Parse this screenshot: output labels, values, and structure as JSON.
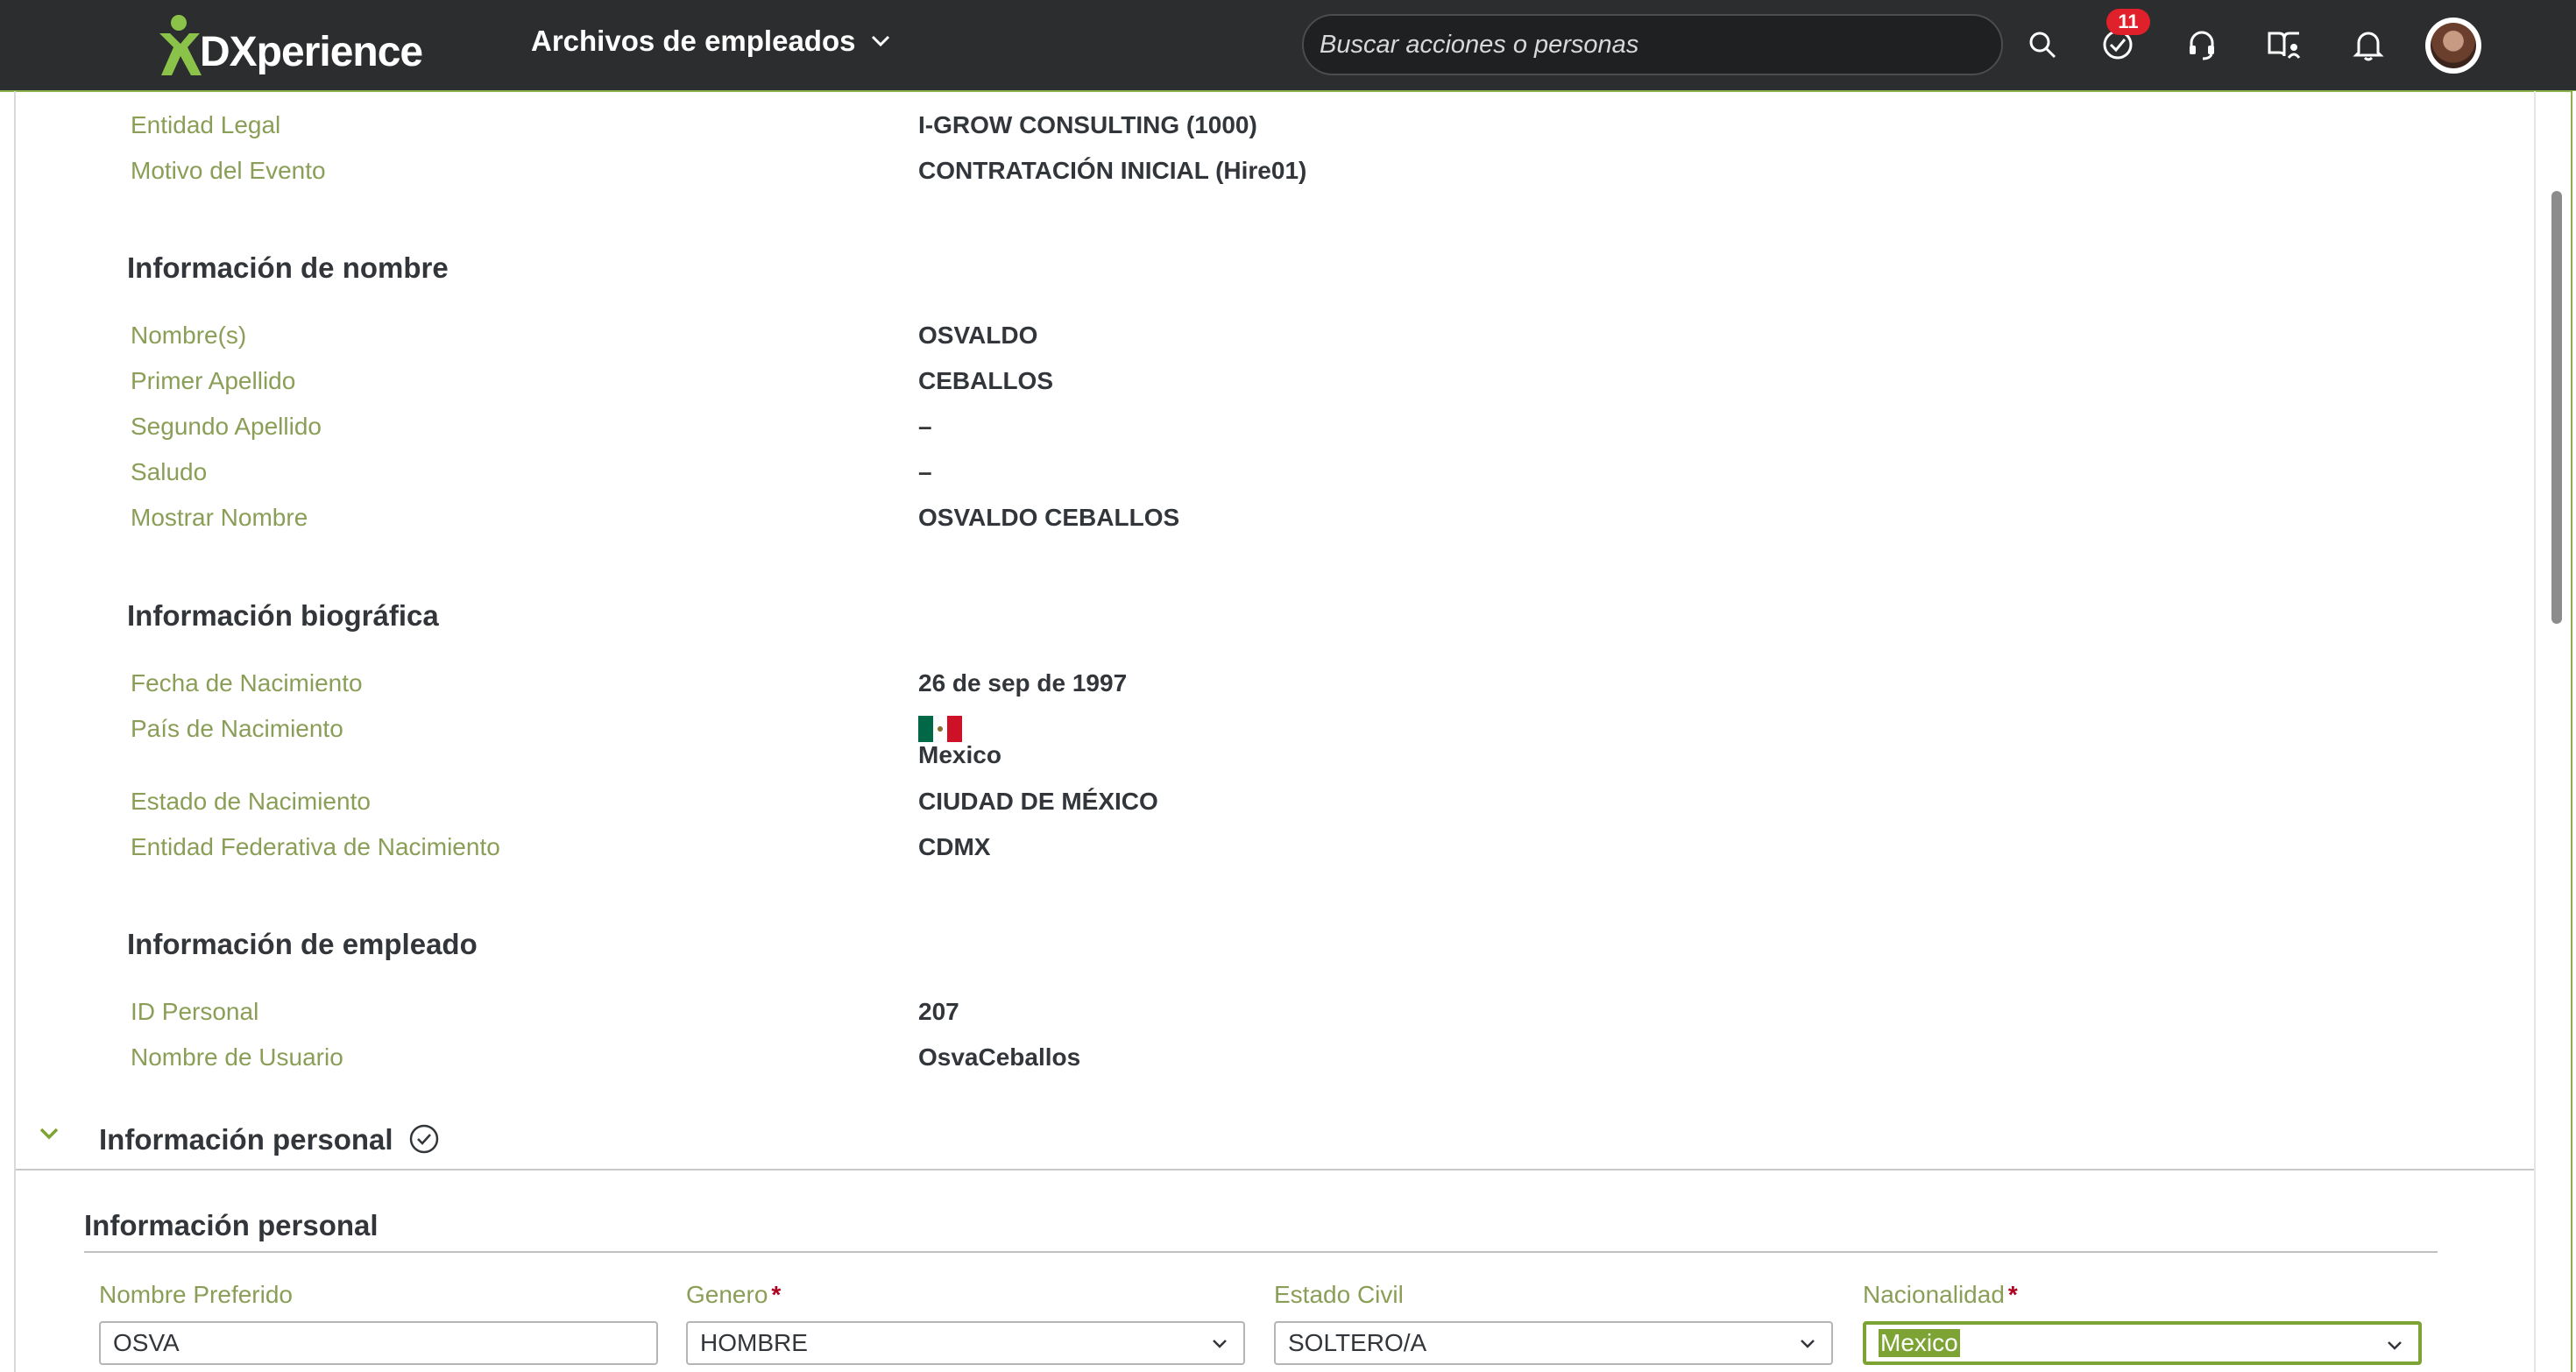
{
  "header": {
    "logo_text": "DXperience",
    "menu_title": "Archivos de empleados",
    "search_placeholder": "Buscar acciones o personas",
    "todo_badge": "11",
    "icons": [
      "search-icon",
      "todo-check-icon",
      "support-headset-icon",
      "learning-book-icon",
      "notification-bell-icon"
    ]
  },
  "event": {
    "rows": [
      {
        "label": "Entidad Legal",
        "value": "I-GROW CONSULTING (1000)"
      },
      {
        "label": "Motivo del Evento",
        "value": "CONTRATACIÓN INICIAL (Hire01)"
      }
    ]
  },
  "name_info": {
    "title": "Información de nombre",
    "rows": [
      {
        "label": "Nombre(s)",
        "value": "OSVALDO"
      },
      {
        "label": "Primer Apellido",
        "value": "CEBALLOS"
      },
      {
        "label": "Segundo Apellido",
        "value": "–"
      },
      {
        "label": "Saludo",
        "value": "–"
      },
      {
        "label": "Mostrar Nombre",
        "value": "OSVALDO CEBALLOS"
      }
    ]
  },
  "bio_info": {
    "title": "Información biográfica",
    "rows": [
      {
        "label": "Fecha de Nacimiento",
        "value": "26 de sep de 1997"
      },
      {
        "label": "País de Nacimiento",
        "value": "Mexico"
      },
      {
        "label": "Estado de Nacimiento",
        "value": "CIUDAD DE MÉXICO"
      },
      {
        "label": "Entidad Federativa de Nacimiento",
        "value": "CDMX"
      }
    ],
    "flag_colors": [
      "#006847",
      "#ffffff",
      "#ce1126"
    ]
  },
  "employee_info": {
    "title": "Información de empleado",
    "rows": [
      {
        "label": "ID Personal",
        "value": "207"
      },
      {
        "label": "Nombre de Usuario",
        "value": "OsvaCeballos"
      }
    ]
  },
  "personal": {
    "section_title": "Información personal",
    "subsection_title": "Información personal",
    "fields": [
      {
        "label": "Nombre Preferido",
        "value": "OSVA",
        "required": false
      },
      {
        "label": "Genero",
        "value": "HOMBRE",
        "required": true
      },
      {
        "label": "Estado Civil",
        "value": "SOLTERO/A",
        "required": false
      },
      {
        "label": "Nacionalidad",
        "value": "Mexico",
        "required": true
      }
    ],
    "required_mark": "*"
  },
  "colors": {
    "header_bg": "#2b2d2e",
    "accent_green": "#7ea335",
    "label_green": "#8b9e57"
  }
}
